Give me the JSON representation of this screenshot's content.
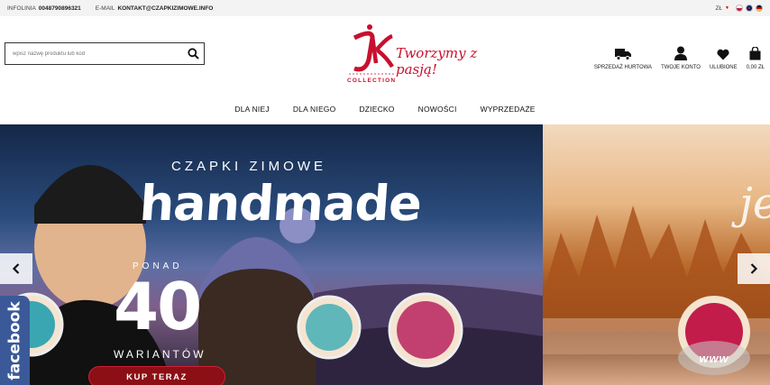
{
  "topbar": {
    "hotline_label": "INFOLINIA",
    "hotline_value": "0048790896321",
    "email_label": "E-MAIL",
    "email_value": "KONTAKT@CZAPKIZIMOWE.INFO",
    "currency": "ZŁ",
    "languages": [
      "pl",
      "en",
      "de"
    ]
  },
  "search": {
    "placeholder": "wpisz nazwę produktu lub kod"
  },
  "logo": {
    "tagline": "Tworzymy z pasją!",
    "collection": "COLLECTION"
  },
  "header_icons": [
    {
      "icon": "truck-icon",
      "label": "SPRZEDAŻ HURTOWA"
    },
    {
      "icon": "user-icon",
      "label": "TWOJE KONTO"
    },
    {
      "icon": "heart-icon",
      "label": "ULUBIONE"
    },
    {
      "icon": "bag-icon",
      "label": "0,00 ZŁ"
    }
  ],
  "nav": {
    "items": [
      "DLA NIEJ",
      "DLA NIEGO",
      "DZIECKO",
      "NOWOŚCI",
      "WYPRZEDAŻE"
    ]
  },
  "slider": {
    "slide1": {
      "subtitle": "CZAPKI ZIMOWE",
      "title": "handmade",
      "ponad": "PONAD",
      "count": "40",
      "warianty": "WARIANTÓW",
      "cta": "KUP TERAZ"
    },
    "slide2": {
      "text": "je",
      "badge": "www"
    }
  },
  "facebook": {
    "label": "facebook"
  },
  "colors": {
    "brand_red": "#c8102e",
    "facebook_blue": "#3b5998"
  }
}
